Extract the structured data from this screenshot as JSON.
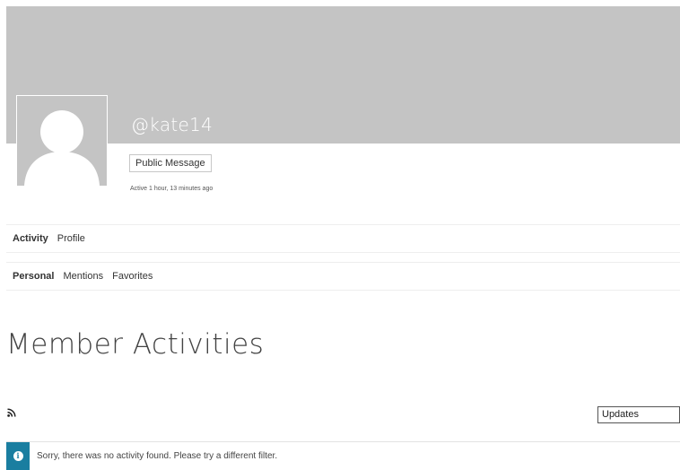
{
  "profile": {
    "username": "@kate14",
    "public_message_label": "Public Message",
    "last_active": "Active 1 hour, 13 minutes ago"
  },
  "primary_nav": {
    "items": [
      {
        "label": "Activity",
        "current": true
      },
      {
        "label": "Profile",
        "current": false
      }
    ]
  },
  "sub_nav": {
    "items": [
      {
        "label": "Personal",
        "current": true
      },
      {
        "label": "Mentions",
        "current": false
      },
      {
        "label": "Favorites",
        "current": false
      }
    ]
  },
  "main": {
    "title": "Member Activities",
    "filter_selected": "Updates",
    "rss_icon": "rss-icon",
    "notice_icon": "info-icon",
    "notice_text": "Sorry, there was no activity found. Please try a different filter."
  },
  "colors": {
    "cover": "#c4c4c4",
    "notice_accent": "#1a7ea0"
  }
}
